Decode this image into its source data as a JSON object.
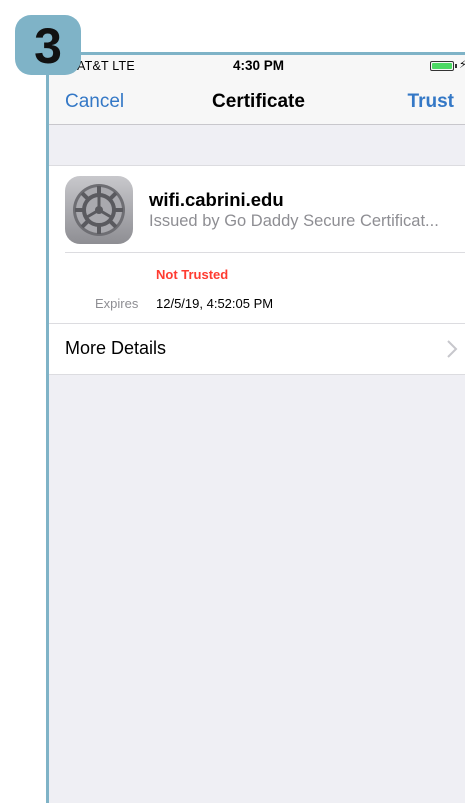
{
  "step": {
    "number": "3"
  },
  "status_bar": {
    "carrier": "AT&T  LTE",
    "time": "4:30 PM",
    "battery_icon": "battery-icon",
    "charging_icon": "bolt-icon"
  },
  "nav": {
    "cancel_label": "Cancel",
    "title": "Certificate",
    "trust_label": "Trust"
  },
  "certificate": {
    "icon": "settings-gear-icon",
    "name": "wifi.cabrini.edu",
    "issuer": "Issued by Go Daddy Secure Certificat...",
    "trust_status": "Not Trusted",
    "expires_label": "Expires",
    "expires_value": "12/5/19, 4:52:05 PM"
  },
  "more_details": {
    "label": "More Details",
    "icon": "chevron-right-icon"
  },
  "colors": {
    "accent": "#3478c6",
    "warning": "#ff3b30",
    "badge": "#7fb3c7",
    "background": "#efeff4"
  }
}
